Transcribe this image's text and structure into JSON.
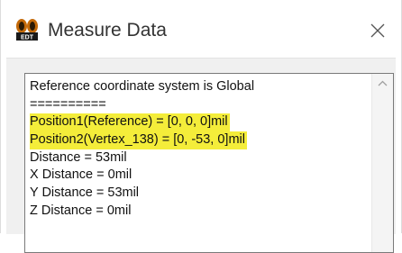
{
  "window": {
    "title": "Measure Data",
    "app_icon": "edt-app-icon",
    "close_icon": "close-icon"
  },
  "results": {
    "lines": [
      {
        "text": "Reference coordinate system is Global",
        "highlighted": false
      },
      {
        "text": "==========",
        "highlighted": false
      },
      {
        "text": "Position1(Reference) = [0, 0, 0]mil",
        "highlighted": true
      },
      {
        "text": "Position2(Vertex_138) = [0, -53, 0]mil",
        "highlighted": true
      },
      {
        "text": "Distance = 53mil",
        "highlighted": false
      },
      {
        "text": "X Distance = 0mil",
        "highlighted": false
      },
      {
        "text": "Y Distance = 53mil",
        "highlighted": false
      },
      {
        "text": "Z Distance = 0mil",
        "highlighted": false
      }
    ],
    "highlight_color": "#f4ed3a",
    "scroll_up_icon": "chevron-up-icon"
  }
}
